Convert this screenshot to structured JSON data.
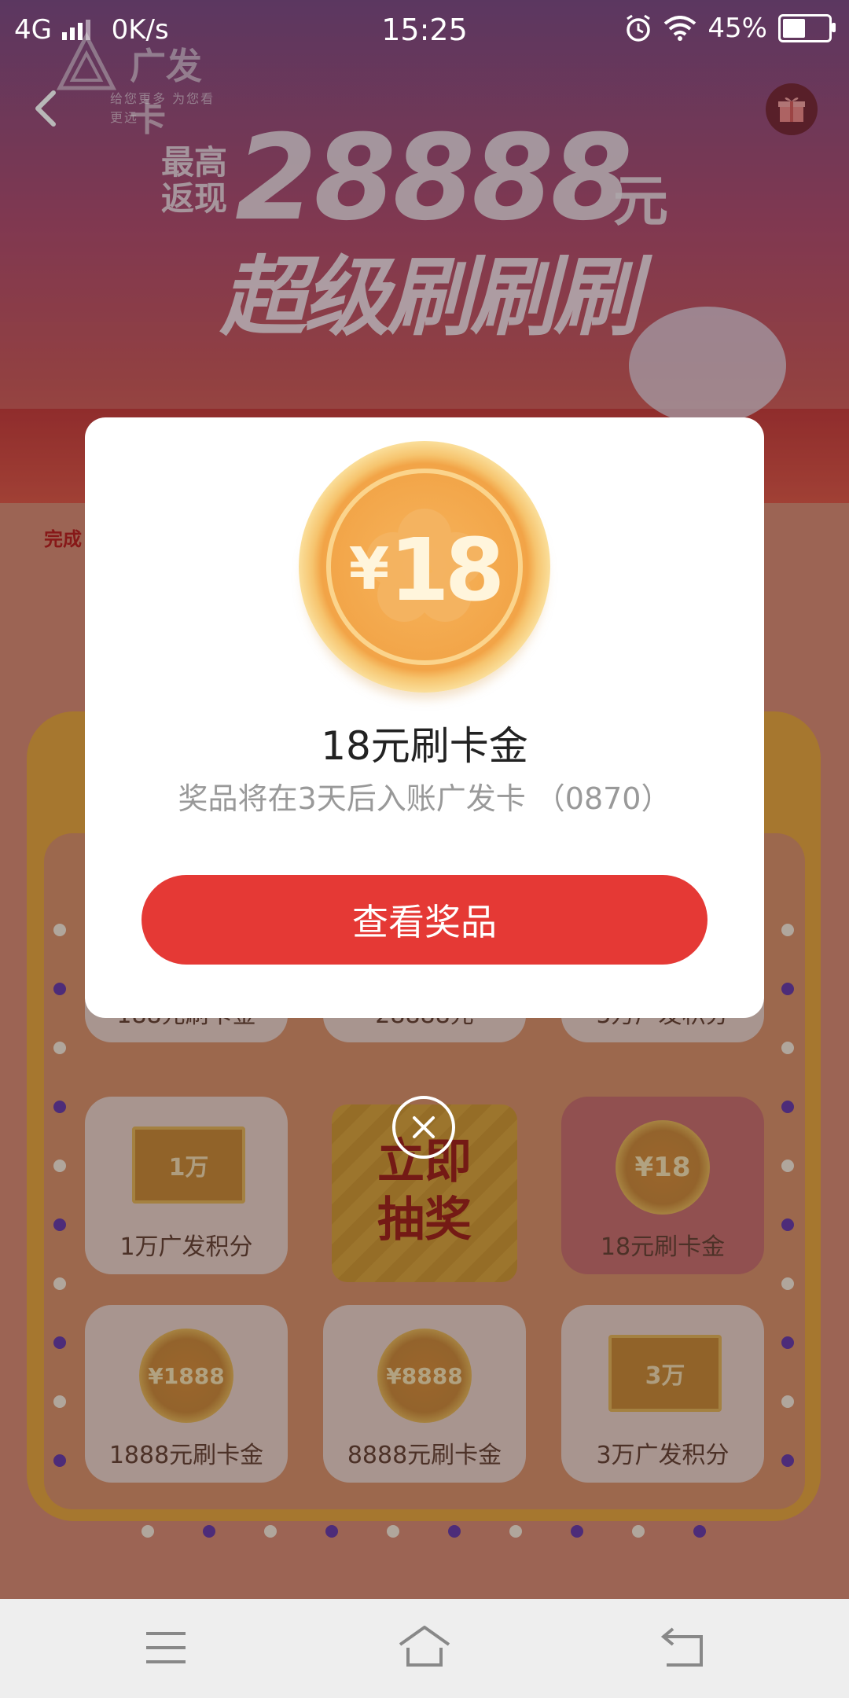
{
  "status_bar": {
    "network": "4G",
    "speed": "0K/s",
    "time": "15:25",
    "battery": "45%",
    "battery_level": 0.45
  },
  "header": {
    "brand": "广发卡",
    "slogan": "给您更多  为您看更远"
  },
  "banner": {
    "prefix": "最高返现",
    "amount": "28888",
    "unit": "元",
    "title": "超级刷刷刷",
    "hint": "完成"
  },
  "prize_grid": {
    "row1": [
      "188元刷卡金",
      "28888元",
      "5万广发积分"
    ],
    "row2": [
      {
        "icon_text": "1万",
        "label": "1万广发积分"
      },
      {
        "label": "立即抽奖"
      },
      {
        "icon_text": "¥18",
        "label": "18元刷卡金"
      }
    ],
    "row3": [
      {
        "icon_text": "¥1888",
        "label": "1888元刷卡金"
      },
      {
        "icon_text": "¥8888",
        "label": "8888元刷卡金"
      },
      {
        "icon_text": "3万",
        "label": "3万广发积分"
      }
    ],
    "lottery_line1": "立即",
    "lottery_line2": "抽奖"
  },
  "modal": {
    "coin_symbol": "¥",
    "coin_value": "18",
    "prize_title": "18元刷卡金",
    "prize_desc": "奖品将在3天后入账广发卡 （0870）",
    "button_label": "查看奖品"
  },
  "colors": {
    "accent": "#e53935",
    "coin": "#f2a447"
  },
  "icons": [
    "back-icon",
    "gift-icon",
    "close-icon",
    "menu-icon",
    "home-icon",
    "return-icon"
  ]
}
